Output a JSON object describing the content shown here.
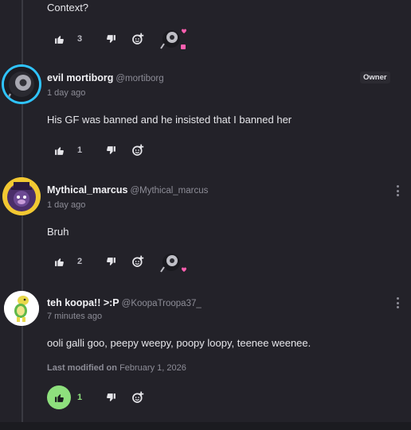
{
  "comments": [
    {
      "text": "Context?",
      "likes": "3",
      "has_reaction": true
    },
    {
      "author": "evil mortiborg",
      "handle": "@mortiborg",
      "badge": "Owner",
      "time": "1 day ago",
      "text": "His GF was banned and he insisted that I banned her",
      "likes": "1"
    },
    {
      "author": "Mythical_marcus",
      "handle": "@Mythical_marcus",
      "time": "1 day ago",
      "text": "Bruh",
      "likes": "2",
      "has_reaction": true
    },
    {
      "author": "teh koopa!! >:P",
      "handle": "@KoopaTroopa37_",
      "time": "7 minutes ago",
      "text": "ooli galli goo, peepy weepy, poopy loopy, teenee weenee.",
      "modified_label": "Last modified on",
      "modified_date": "February 1, 2026",
      "likes": "1",
      "liked_by_me": true
    }
  ],
  "colors": {
    "background": "#232229",
    "like_active": "#8ee07d",
    "reaction_heart": "#ff5fb0"
  },
  "icons": {
    "like": "thumbs-up-icon",
    "dislike": "thumbs-down-icon",
    "react": "add-reaction-icon",
    "more": "kebab-menu-icon"
  }
}
